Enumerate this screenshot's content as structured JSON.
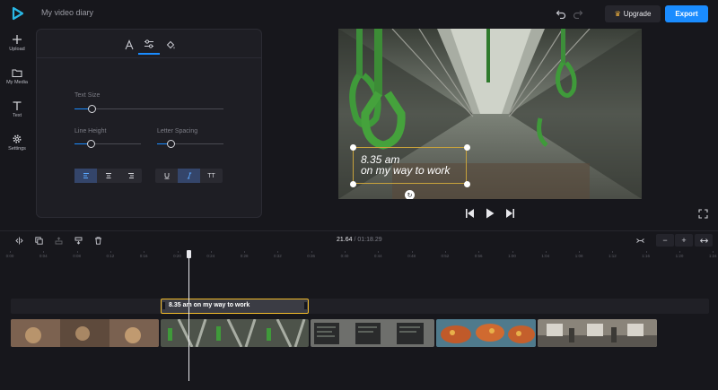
{
  "app": {
    "project_name": "My video diary"
  },
  "header": {
    "upgrade_label": "Upgrade",
    "export_label": "Export",
    "accent": "#1a8cff"
  },
  "nav": {
    "items": [
      {
        "label": "Upload",
        "icon": "plus-icon"
      },
      {
        "label": "My Media",
        "icon": "folder-icon"
      },
      {
        "label": "Text",
        "icon": "text-icon"
      },
      {
        "label": "Settings",
        "icon": "gear-icon"
      }
    ]
  },
  "text_panel": {
    "tabs": [
      {
        "icon": "font-icon"
      },
      {
        "icon": "sliders-icon",
        "active": true
      },
      {
        "icon": "paint-bucket-icon"
      }
    ],
    "text_size_label": "Text Size",
    "line_height_label": "Line Height",
    "letter_spacing_label": "Letter Spacing",
    "text_size_value": 0.12,
    "line_height_value": 0.25,
    "letter_spacing_value": 0.21,
    "align_buttons": [
      {
        "icon": "align-left-icon",
        "active": true
      },
      {
        "icon": "align-center-icon"
      },
      {
        "icon": "align-right-icon"
      }
    ],
    "style_buttons": [
      {
        "icon": "underline-icon"
      },
      {
        "icon": "italic-icon",
        "active": true
      },
      {
        "label": "TT"
      }
    ]
  },
  "preview": {
    "caption_line1": "8.35 am",
    "caption_line2": "on my way to work"
  },
  "timeline": {
    "current_time": "21.64",
    "separator": "/",
    "total_time": "01:18.29",
    "zoom_minus": "−",
    "zoom_plus": "+",
    "ruler_ticks": [
      "0:00",
      "0:04",
      "0:08",
      "0:12",
      "0:16",
      "0:20",
      "0:24",
      "0:28",
      "0:32",
      "0:36",
      "0:40",
      "0:44",
      "0:48",
      "0:52",
      "0:56",
      "1:00",
      "1:04",
      "1:08",
      "1:12",
      "1:16",
      "1:20",
      "1:24"
    ],
    "text_clip_label": "8.35 am on my way to work"
  }
}
